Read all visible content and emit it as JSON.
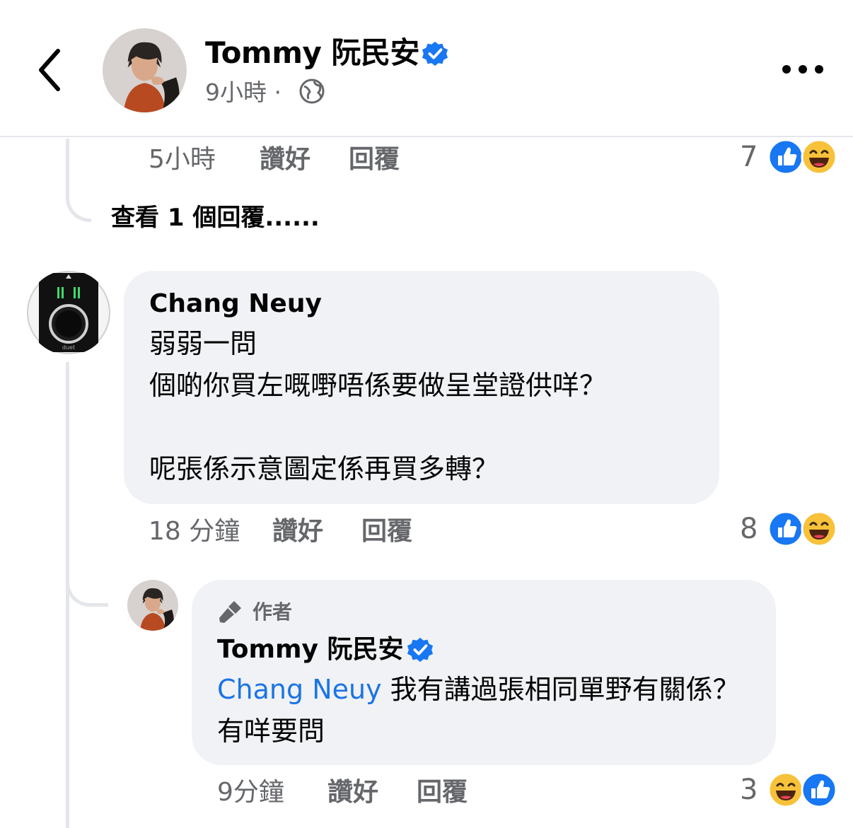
{
  "header": {
    "author_name": "Tommy 阮民安",
    "post_time": "9小時 ·",
    "back_icon": "chevron-left-icon",
    "more_icon": "more-dots-icon"
  },
  "prev_comment": {
    "time": "5小時",
    "like_label": "讚好",
    "reply_label": "回覆",
    "reaction_count": "7",
    "reactions": [
      "like",
      "haha"
    ]
  },
  "view_more_replies": "查看 1 個回覆......",
  "comment": {
    "name": "Chang Neuy",
    "text": "弱弱一問\n個啲你買左嘅嘢唔係要做呈堂證供咩？\n\n呢張係示意圖定係再買多轉？",
    "time": "18 分鐘",
    "like_label": "讚好",
    "reply_label": "回覆",
    "reaction_count": "8",
    "reactions": [
      "like",
      "haha"
    ]
  },
  "reply": {
    "author_badge": "作者",
    "name": "Tommy 阮民安",
    "mention": "Chang Neuy",
    "text": " 我有講過張相同單野有關係？有咩要問",
    "time": "9分鐘",
    "like_label": "讚好",
    "reply_label": "回覆",
    "reaction_count": "3",
    "reactions": [
      "haha",
      "like"
    ]
  },
  "colors": {
    "accent": "#1b74e4",
    "verified": "#1877f2",
    "bubble": "#f0f2f5",
    "secondary_text": "#65676b"
  }
}
